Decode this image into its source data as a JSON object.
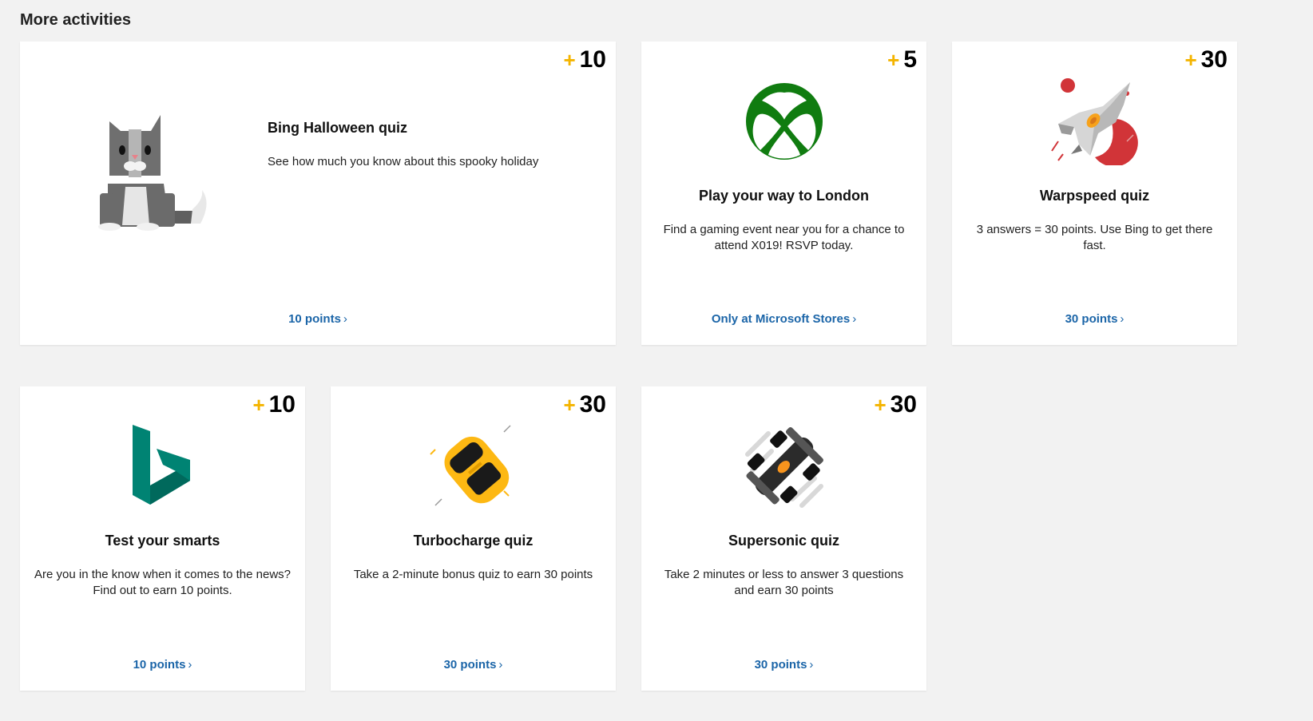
{
  "section": {
    "title": "More activities"
  },
  "cards": [
    {
      "plus": "+",
      "points": "10",
      "title": "Bing Halloween quiz",
      "description": "See how much you know about this spooky holiday",
      "link": "10 points",
      "chevron": "›",
      "icon": "cat-icon"
    },
    {
      "plus": "+",
      "points": "5",
      "title": "Play your way to London",
      "description": "Find a gaming event near you for a chance to attend X019! RSVP today.",
      "link": "Only at Microsoft Stores",
      "chevron": "›",
      "icon": "xbox-logo-icon"
    },
    {
      "plus": "+",
      "points": "30",
      "title": "Warpspeed quiz",
      "description": "3 answers = 30 points. Use Bing to get there fast.",
      "link": "30 points",
      "chevron": "›",
      "icon": "spaceship-icon"
    },
    {
      "plus": "+",
      "points": "10",
      "title": "Test your smarts",
      "description": "Are you in the know when it comes to the news? Find out to earn 10 points.",
      "link": "10 points",
      "chevron": "›",
      "icon": "bing-logo-icon"
    },
    {
      "plus": "+",
      "points": "30",
      "title": "Turbocharge quiz",
      "description": "Take a 2-minute bonus quiz to earn 30 points",
      "link": "30 points",
      "chevron": "›",
      "icon": "sports-car-icon"
    },
    {
      "plus": "+",
      "points": "30",
      "title": "Supersonic quiz",
      "description": "Take 2 minutes or less to answer 3 questions and earn 30 points",
      "link": "30 points",
      "chevron": "›",
      "icon": "race-car-icon"
    }
  ],
  "colors": {
    "accent_plus": "#f4b400",
    "link": "#1b65a8",
    "xbox_green": "#107c10",
    "bing_teal": "#008373",
    "background": "#f2f2f2"
  }
}
